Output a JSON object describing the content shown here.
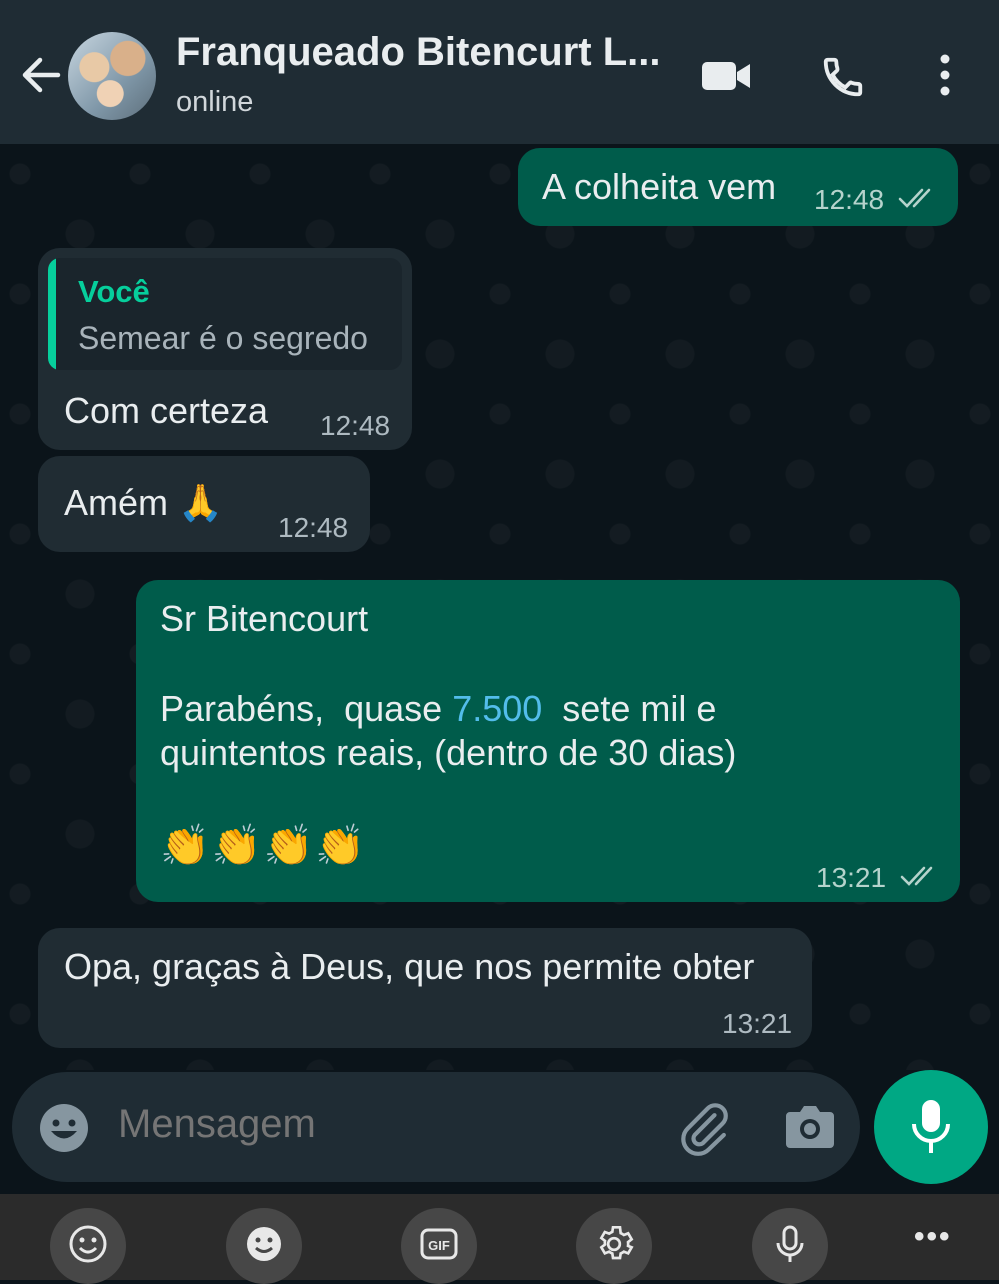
{
  "header": {
    "contact_name": "Franqueado Bitencurt L...",
    "status": "online",
    "icons": [
      "back-arrow-icon",
      "contact-avatar",
      "video-call-icon",
      "voice-call-icon",
      "more-options-icon"
    ]
  },
  "messages": [
    {
      "direction": "outgoing",
      "text": "A colheita vem",
      "time": "12:48",
      "status": "read"
    },
    {
      "direction": "incoming",
      "quote": {
        "author": "Você",
        "text": "Semear é o segredo"
      },
      "text": "Com certeza",
      "time": "12:48"
    },
    {
      "direction": "incoming",
      "text": "Amém 🙏",
      "time": "12:48"
    },
    {
      "direction": "outgoing",
      "lines": [
        "Sr Bitencourt",
        "",
        "Parabéns,  quase ",
        "7.500",
        "  sete mil e",
        "quintentos reais, (dentro de 30 dias)",
        "",
        "👏👏👏👏"
      ],
      "time": "13:21",
      "status": "read"
    },
    {
      "direction": "incoming",
      "text": "Opa, graças à Deus, que nos permite obter",
      "time": "13:21"
    }
  ],
  "composer": {
    "placeholder": "Mensagem",
    "icons": [
      "emoji-icon",
      "attach-icon",
      "camera-icon",
      "mic-icon"
    ]
  },
  "keyboard_toolbar": {
    "icons": [
      "emoji-face-icon",
      "sticker-icon",
      "gif-icon",
      "settings-icon",
      "voice-input-icon",
      "more-icon"
    ],
    "gif_label": "GIF",
    "more_label": "•••"
  },
  "colors": {
    "header_bg": "#1f2c34",
    "chat_bg": "#0b141a",
    "outgoing_bubble": "#005c4b",
    "incoming_bubble": "#202c33",
    "accent": "#00a884",
    "quote_author": "#06cf9c",
    "number_highlight": "#53bdeb"
  }
}
